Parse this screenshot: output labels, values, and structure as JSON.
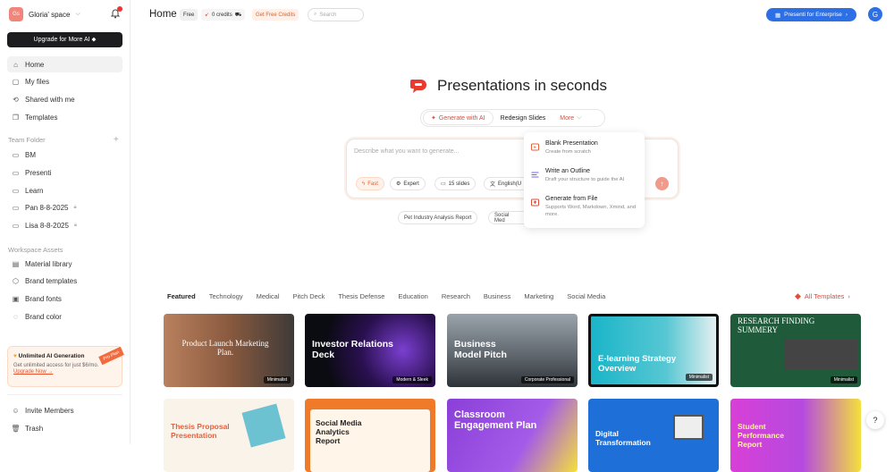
{
  "sidebar": {
    "workspace": {
      "initials": "Gs",
      "name": "Gloria' space"
    },
    "bell_count": "2",
    "upgrade_label": "Upgrade for More AI ⬥",
    "nav": [
      {
        "label": "Home",
        "icon": "home-icon"
      },
      {
        "label": "My files",
        "icon": "file-icon"
      },
      {
        "label": "Shared with me",
        "icon": "share-icon"
      },
      {
        "label": "Templates",
        "icon": "templates-icon"
      }
    ],
    "team_folder_title": "Team Folder",
    "folders": [
      "BM",
      "Presenti",
      "Learn",
      "Pan 8-8-2025",
      "Lisa 8-8-2025"
    ],
    "workspace_assets_title": "Workspace Assets",
    "assets": [
      "Material library",
      "Brand templates",
      "Brand fonts",
      "Brand color"
    ],
    "promo": {
      "title": "Unlimited AI Generation",
      "desc": "Get unlimited access for just $6/mo.",
      "link": "Upgrade Now →",
      "ribbon": "Pro Plan"
    },
    "bottom": [
      "Invite Members",
      "Trash"
    ]
  },
  "topbar": {
    "title": "Home",
    "plan": "Free",
    "credits": "0 credits",
    "free_credits": "Get Free Credits",
    "search_placeholder": "Search",
    "enterprise": "Presenti for Enterprise",
    "avatar": "G"
  },
  "hero": {
    "title": "Presentations in seconds"
  },
  "mode_tabs": [
    "Generate with AI",
    "Redesign Slides",
    "More"
  ],
  "prompt": {
    "placeholder": "Describe what you want to generate...",
    "options": [
      "Fast",
      "Expert",
      "15 slides",
      "English(U"
    ]
  },
  "suggestions": [
    "Pet Industry Analysis Report",
    "Social Med"
  ],
  "more_menu": [
    {
      "title": "Blank Presentation",
      "desc": "Create from scratch"
    },
    {
      "title": "Write an Outline",
      "desc": "Draft your structure to guide the AI"
    },
    {
      "title": "Generate from File",
      "desc": "Supports Word, Markdown, Xmind, and more."
    }
  ],
  "categories": [
    "Featured",
    "Technology",
    "Medical",
    "Pitch Deck",
    "Thesis Defense",
    "Education",
    "Research",
    "Business",
    "Marketing",
    "Social Media"
  ],
  "all_templates": "All Templates",
  "templates_row1": [
    {
      "title": "Product Launch Marketing Plan.",
      "badge": "Minimalist"
    },
    {
      "title": "Investor Relations Deck",
      "badge": "Modern & Sleek"
    },
    {
      "title": "Business Model Pitch",
      "badge": "Corporate Professional"
    },
    {
      "title": "E-learning Strategy Overview",
      "badge": "Minimalist"
    },
    {
      "title": "RESEARCH FINDING SUMMERY",
      "badge": "Minimalist"
    }
  ],
  "templates_row2": [
    {
      "title": "Thesis Proposal Presentation"
    },
    {
      "title": "Social Media Analytics Report"
    },
    {
      "title": "Classroom Engagement Plan"
    },
    {
      "title": "Digital Transformation"
    },
    {
      "title": "Student Performance Report"
    }
  ],
  "colors": {
    "accent": "#e24b3a",
    "brand_blue": "#2d6fe5"
  }
}
